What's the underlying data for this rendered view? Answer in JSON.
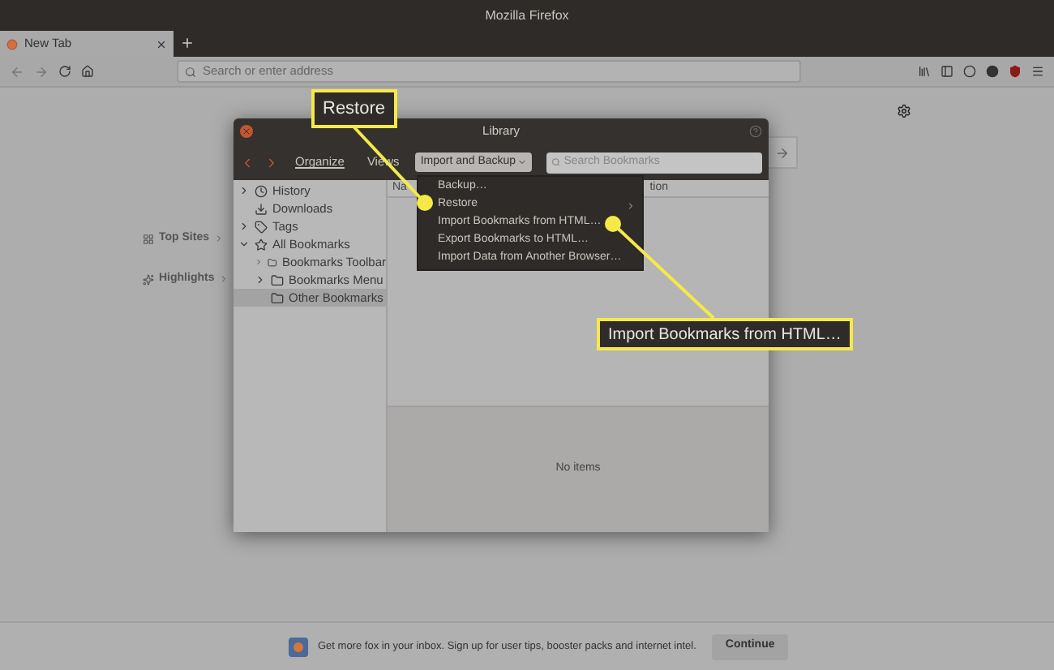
{
  "window": {
    "title": "Mozilla Firefox"
  },
  "tabs": [
    {
      "label": "New Tab",
      "selected": true
    }
  ],
  "address_bar": {
    "placeholder": "Search or enter address"
  },
  "new_tab_sections": [
    {
      "label": "Top Sites"
    },
    {
      "label": "Highlights"
    }
  ],
  "library": {
    "title": "Library",
    "organize": "Organize",
    "views": "Views",
    "import_backup": "Import and Backup",
    "search": {
      "placeholder": "Search Bookmarks"
    },
    "tree": [
      {
        "label": "History",
        "has_children": true,
        "expanded": false,
        "selected": false
      },
      {
        "label": "Downloads",
        "has_children": false,
        "expanded": false,
        "selected": false
      },
      {
        "label": "Tags",
        "has_children": true,
        "expanded": false,
        "selected": false
      },
      {
        "label": "All Bookmarks",
        "has_children": true,
        "expanded": true,
        "selected": false,
        "children": [
          {
            "label": "Bookmarks Toolbar",
            "has_children": true,
            "expanded": false,
            "selected": false
          },
          {
            "label": "Bookmarks Menu",
            "has_children": true,
            "expanded": false,
            "selected": false
          },
          {
            "label": "Other Bookmarks",
            "has_children": false,
            "expanded": false,
            "selected": true
          }
        ]
      }
    ],
    "columns": {
      "column_1": "Na",
      "column_2": "tion"
    },
    "empty_message": "No items"
  },
  "menu": [
    {
      "label": "Backup…",
      "submenu": false
    },
    {
      "label": "Restore",
      "submenu": true
    },
    {
      "label": "Import Bookmarks from HTML…",
      "submenu": false
    },
    {
      "label": "Export Bookmarks to HTML…",
      "submenu": false
    },
    {
      "label": "Import Data from Another Browser…",
      "submenu": false
    }
  ],
  "callouts": [
    {
      "label": "Restore"
    },
    {
      "label": "Import Bookmarks from HTML…"
    }
  ],
  "snippet": {
    "text": "Get more fox in your inbox. Sign up for user tips, booster packs and internet intel.",
    "button": "Continue"
  }
}
